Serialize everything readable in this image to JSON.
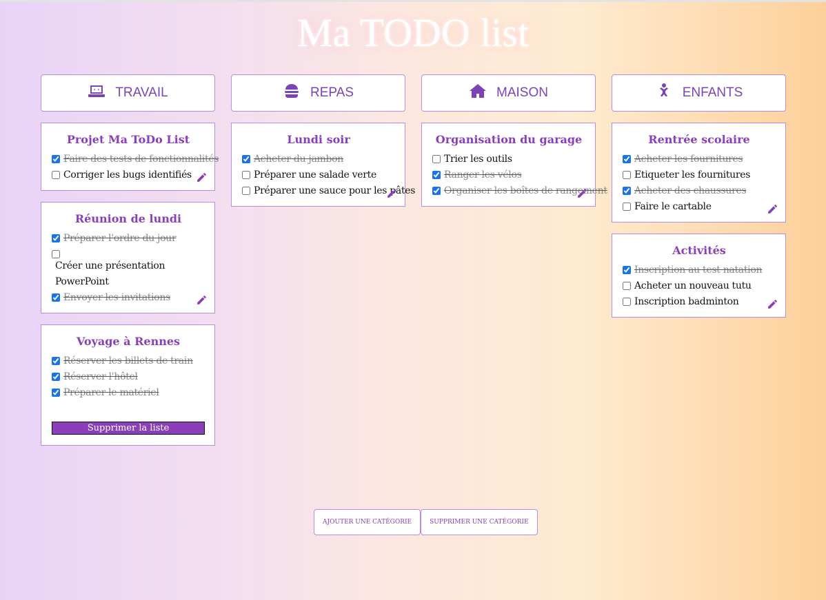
{
  "page": {
    "title": "Ma TODO list"
  },
  "colors": {
    "accent": "#8a3fb8",
    "border": "#b98ce0"
  },
  "categories": [
    {
      "name": "TRAVAIL",
      "icon": "laptop-code-icon",
      "lists": [
        {
          "title": "Projet Ma ToDo List",
          "tasks": [
            {
              "text": "Faire des tests de fonctionnalités",
              "done": true
            },
            {
              "text": "Corriger les bugs identifiés",
              "done": false
            }
          ]
        },
        {
          "title": "Réunion de lundi",
          "tasks": [
            {
              "text": "Préparer l'ordre du jour",
              "done": true
            },
            {
              "text": "Créer une présentation PowerPoint",
              "done": false
            },
            {
              "text": "Envoyer les invitations",
              "done": true
            }
          ]
        },
        {
          "title": "Voyage à Rennes",
          "delete_label": "Supprimer la liste",
          "tasks": [
            {
              "text": "Réserver les billets de train",
              "done": true
            },
            {
              "text": "Réserver l'hôtel",
              "done": true
            },
            {
              "text": "Préparer le matériel",
              "done": true
            }
          ]
        }
      ]
    },
    {
      "name": "REPAS",
      "icon": "burger-icon",
      "lists": [
        {
          "title": "Lundi soir",
          "tasks": [
            {
              "text": "Acheter du jambon",
              "done": true
            },
            {
              "text": "Préparer une salade verte",
              "done": false
            },
            {
              "text": "Préparer une sauce pour les pâtes",
              "done": false
            }
          ]
        }
      ]
    },
    {
      "name": "MAISON",
      "icon": "house-icon",
      "lists": [
        {
          "title": "Organisation du garage",
          "tasks": [
            {
              "text": "Trier les outils",
              "done": false
            },
            {
              "text": "Ranger les vélos",
              "done": true
            },
            {
              "text": "Organiser les boîtes de rangement",
              "done": true
            }
          ]
        }
      ]
    },
    {
      "name": "ENFANTS",
      "icon": "child-icon",
      "lists": [
        {
          "title": "Rentrée scolaire",
          "tasks": [
            {
              "text": "Acheter les fournitures",
              "done": true
            },
            {
              "text": "Etiqueter les fournitures",
              "done": false
            },
            {
              "text": "Acheter des chaussures",
              "done": true
            },
            {
              "text": "Faire le cartable",
              "done": false
            }
          ]
        },
        {
          "title": "Activités",
          "tasks": [
            {
              "text": "Inscription au test natation",
              "done": true
            },
            {
              "text": "Acheter un nouveau tutu",
              "done": false
            },
            {
              "text": "Inscription badminton",
              "done": false
            }
          ]
        }
      ]
    }
  ],
  "actions": {
    "add_category": "AJOUTER UNE CATÉGORIE",
    "remove_category": "SUPPRIMER UNE CATÉGORIE"
  }
}
